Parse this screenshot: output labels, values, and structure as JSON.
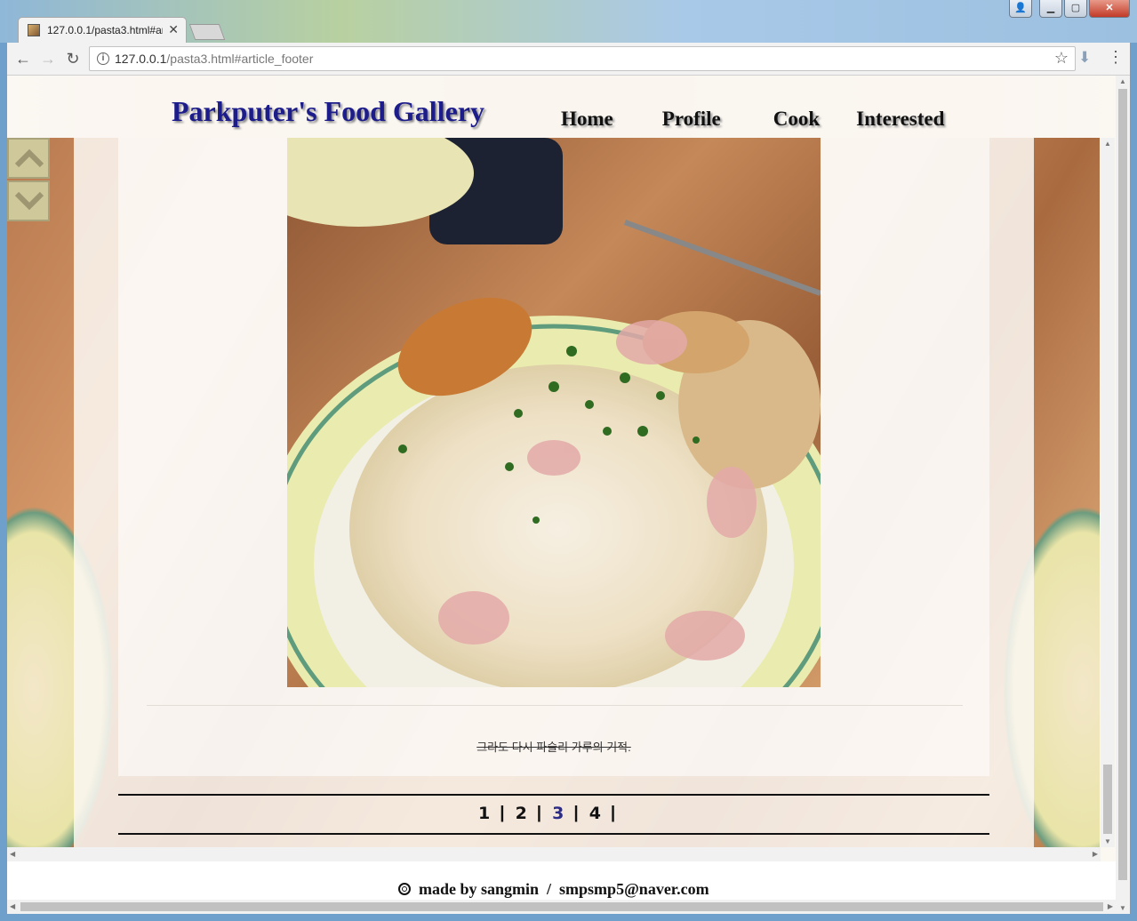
{
  "browser": {
    "tab_title": "127.0.0.1/pasta3.html#article_footer",
    "url_host": "127.0.0.1",
    "url_path": "/pasta3.html#article_footer"
  },
  "site": {
    "title": "Parkputer's Food Gallery",
    "nav": [
      "Home",
      "Profile",
      "Cook",
      "Interested"
    ]
  },
  "article": {
    "caption": "그라도 다시 파슬리 가루의 기적."
  },
  "pagination": {
    "pages": [
      "1",
      "2",
      "3",
      "4"
    ],
    "separator": "|",
    "current": "3"
  },
  "footer": {
    "author": "made by sangmin",
    "divider": "/",
    "email": "smpsmp5@naver.com"
  }
}
